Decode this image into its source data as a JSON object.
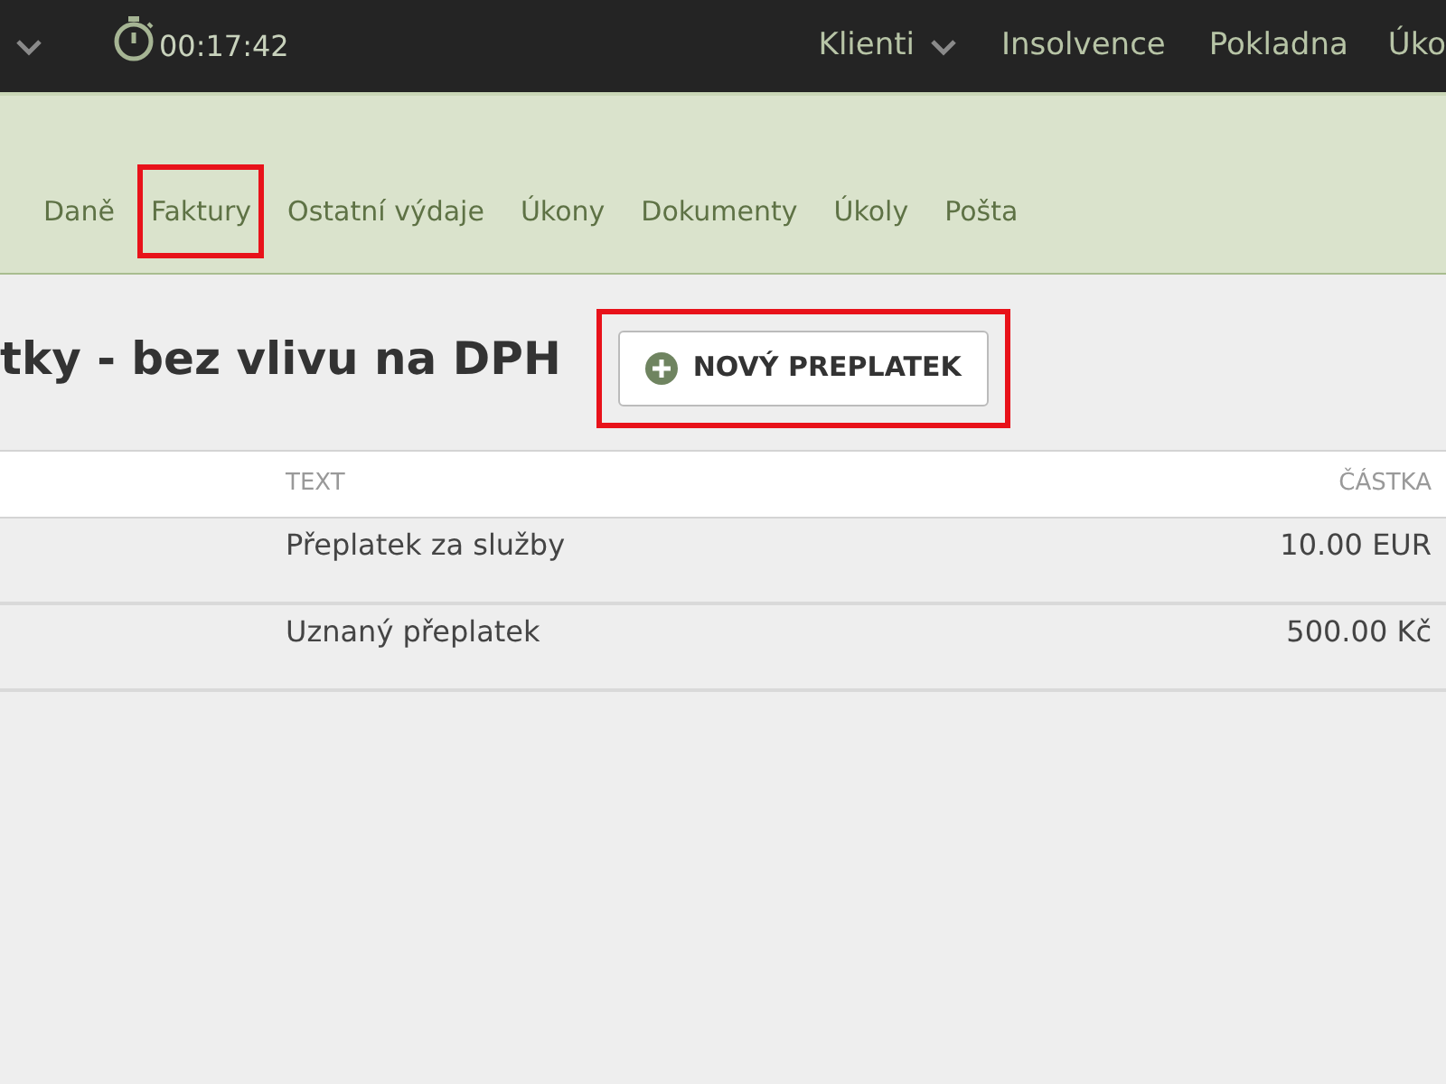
{
  "top_bar": {
    "timer": "00:17:42",
    "nav": [
      {
        "label": "Klienti",
        "dropdown": true
      },
      {
        "label": "Insolvence",
        "dropdown": false
      },
      {
        "label": "Pokladna",
        "dropdown": false
      },
      {
        "label": "Úko",
        "dropdown": false
      }
    ]
  },
  "tabs": [
    {
      "label": "Daně",
      "highlighted": false
    },
    {
      "label": "Faktury",
      "highlighted": true
    },
    {
      "label": "Ostatní výdaje",
      "highlighted": false
    },
    {
      "label": "Úkony",
      "highlighted": false
    },
    {
      "label": "Dokumenty",
      "highlighted": false
    },
    {
      "label": "Úkoly",
      "highlighted": false
    },
    {
      "label": "Pošta",
      "highlighted": false
    }
  ],
  "heading": "tky - bez vlivu na DPH",
  "new_button": {
    "label": "NOVÝ PREPLATEK",
    "highlighted": true
  },
  "table": {
    "columns": [
      "TEXT",
      "ČÁSTKA"
    ],
    "rows": [
      {
        "text": "Přeplatek za služby",
        "amount": "10.00 EUR"
      },
      {
        "text": "Uznaný přeplatek",
        "amount": "500.00 Kč"
      }
    ]
  }
}
